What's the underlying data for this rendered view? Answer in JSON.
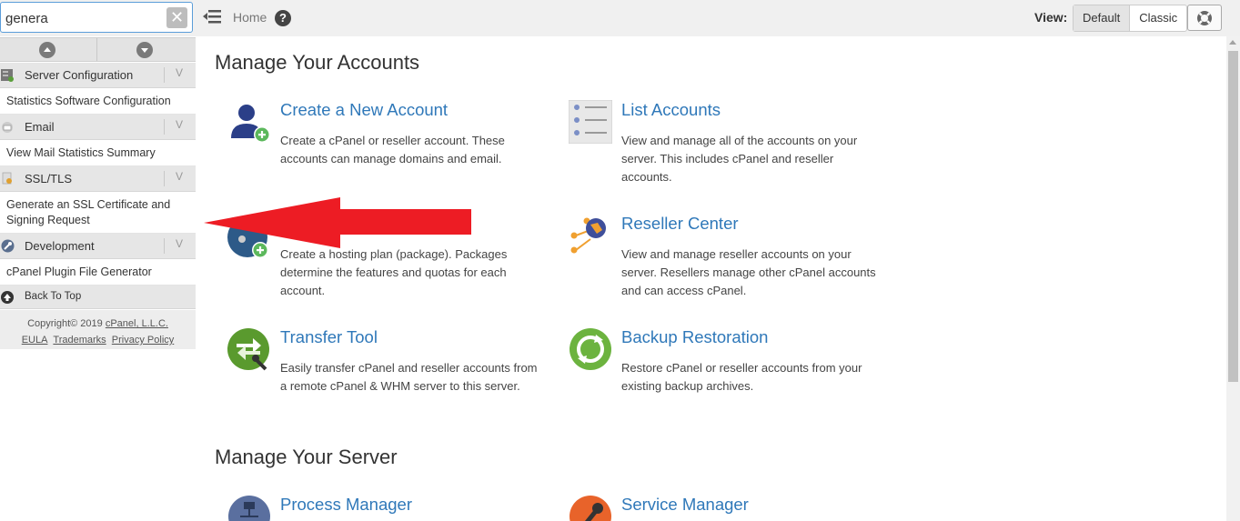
{
  "search": {
    "value": "genera"
  },
  "sidebar": {
    "categories": [
      {
        "label": "Server Configuration",
        "item": "Statistics Software Configuration"
      },
      {
        "label": "Email",
        "item": "View Mail Statistics Summary"
      },
      {
        "label": "SSL/TLS",
        "item": "Generate an SSL Certificate and Signing Request"
      },
      {
        "label": "Development",
        "item": "cPanel Plugin File Generator"
      }
    ],
    "back_to_top": "Back To Top",
    "copyright": "Copyright© 2019",
    "company": "cPanel, L.L.C.",
    "eula": "EULA",
    "trademarks": "Trademarks",
    "privacy": "Privacy Policy"
  },
  "topbar": {
    "breadcrumb": "Home",
    "help": "?",
    "view_label": "View:",
    "view_default": "Default",
    "view_classic": "Classic"
  },
  "main": {
    "accounts_title": "Manage Your Accounts",
    "server_title": "Manage Your Server",
    "cards": [
      {
        "title": "Create a New Account",
        "desc": "Create a cPanel or reseller account. These accounts can manage domains and email."
      },
      {
        "title": "List Accounts",
        "desc": "View and manage all of the accounts on your server. This includes cPanel and reseller accounts."
      },
      {
        "title": "",
        "desc": "Create a hosting plan (package). Packages determine the features and quotas for each account."
      },
      {
        "title": "Reseller Center",
        "desc": "View and manage reseller accounts on your server. Resellers manage other cPanel accounts and can access cPanel."
      },
      {
        "title": "Transfer Tool",
        "desc": "Easily transfer cPanel and reseller accounts from a remote cPanel & WHM server to this server."
      },
      {
        "title": "Backup Restoration",
        "desc": "Restore cPanel or reseller accounts from your existing backup archives."
      },
      {
        "title": "Process Manager",
        "desc": ""
      },
      {
        "title": "Service Manager",
        "desc": ""
      }
    ]
  },
  "colors": {
    "link": "#2f78b9",
    "annotation_arrow": "#ed1c24",
    "sidebar_category_bg": "#e6e6e6"
  }
}
